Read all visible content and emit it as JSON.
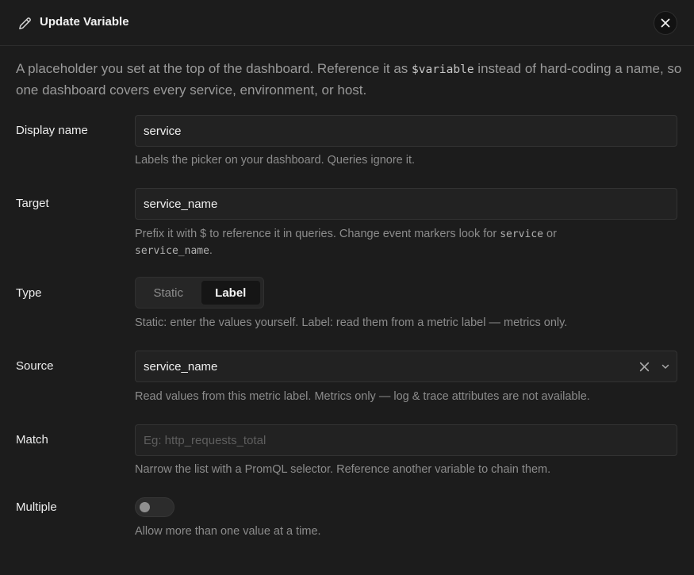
{
  "dialog": {
    "title": "Update Variable",
    "close_icon": "close-icon",
    "title_icon": "pencil-icon"
  },
  "intro": {
    "before": "A placeholder you set at the top of the dashboard. Reference it as ",
    "code": "$variable",
    "after": " instead of hard-coding a name, so one dashboard covers every service, environment, or host."
  },
  "fields": {
    "display_name": {
      "label": "Display name",
      "value": "service",
      "help": "Labels the picker on your dashboard. Queries ignore it."
    },
    "target": {
      "label": "Target",
      "value": "service_name",
      "help_before": "Prefix it with $ to reference it in queries. Change event markers look for ",
      "help_code1": "service",
      "help_mid": " or ",
      "help_code2": "service_name",
      "help_after": "."
    },
    "type": {
      "label": "Type",
      "options": [
        "Static",
        "Label"
      ],
      "selected": "Label",
      "help": "Static: enter the values yourself. Label: read them from a metric label — metrics only."
    },
    "source": {
      "label": "Source",
      "value": "service_name",
      "help": "Read values from this metric label. Metrics only — log & trace attributes are not available."
    },
    "match": {
      "label": "Match",
      "value": "",
      "placeholder": "Eg: http_requests_total",
      "help": "Narrow the list with a PromQL selector. Reference another variable to chain them."
    },
    "multiple": {
      "label": "Multiple",
      "enabled": false,
      "help": "Allow more than one value at a time."
    }
  },
  "colors": {
    "background": "#1c1c1c",
    "field_bg": "#222222",
    "border": "#333333",
    "muted_text": "#8c8c8c"
  }
}
